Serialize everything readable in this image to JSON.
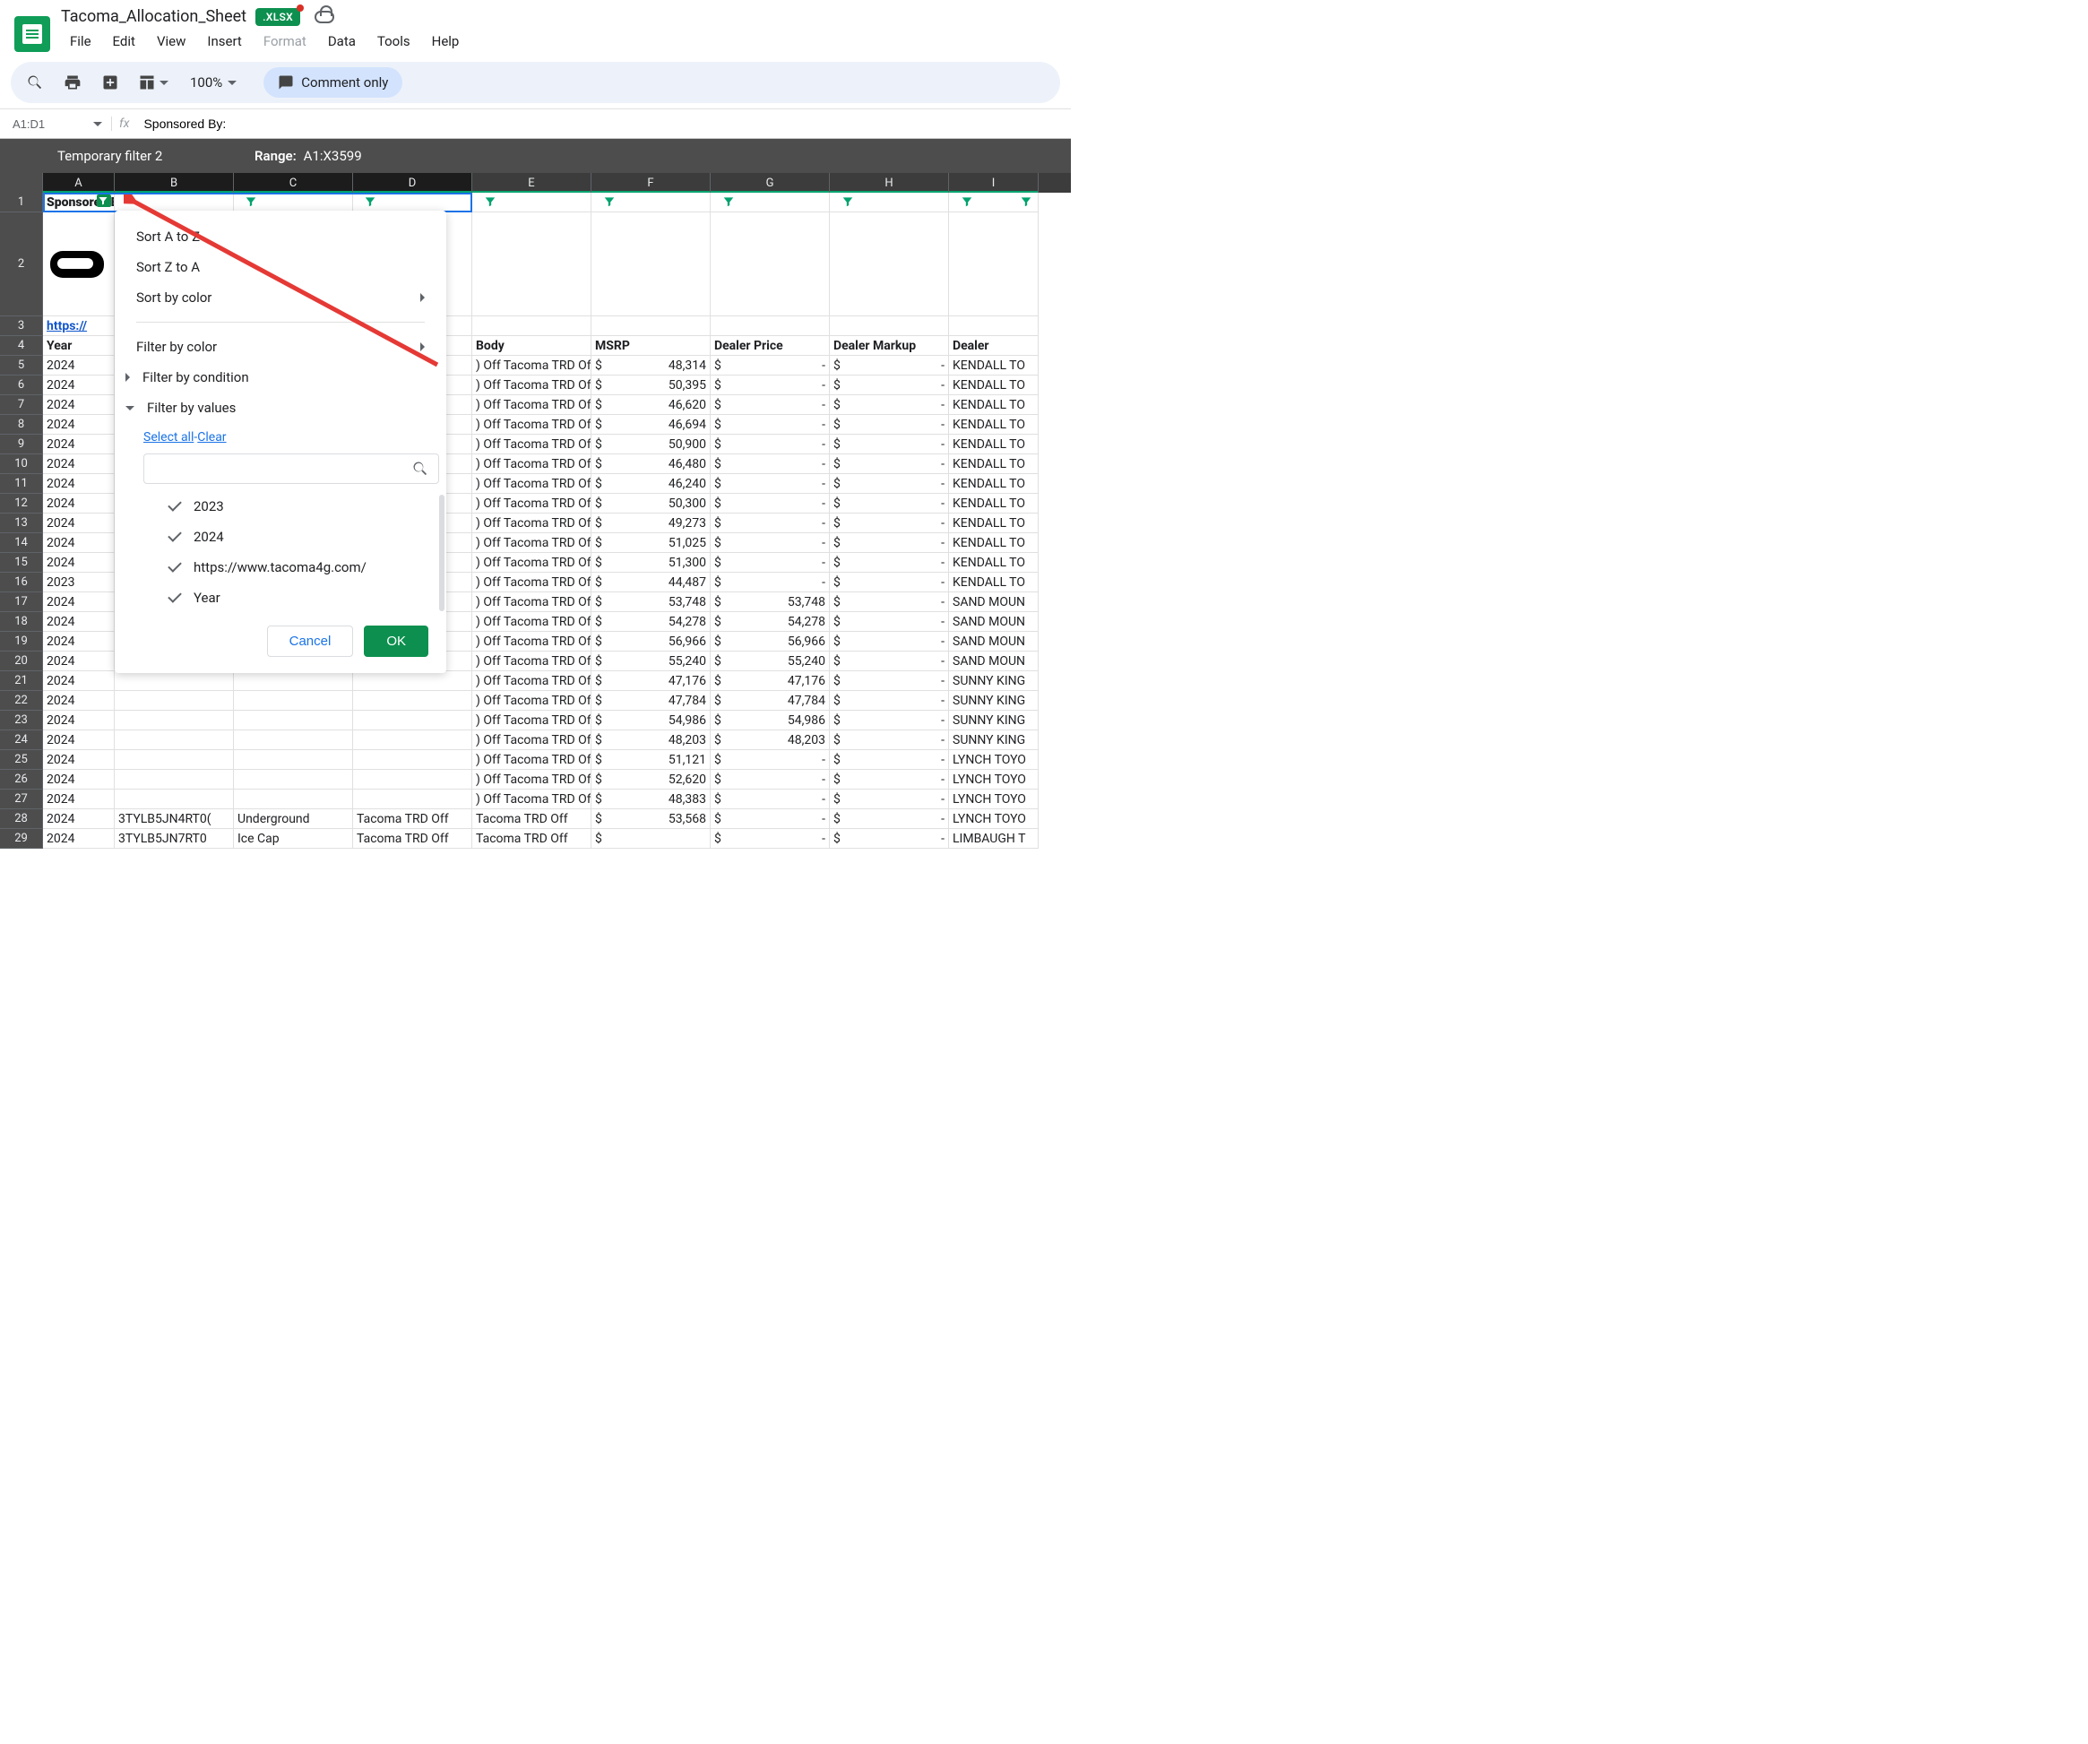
{
  "document": {
    "title": "Tacoma_Allocation_Sheet",
    "badge": ".XLSX"
  },
  "menu": {
    "file": "File",
    "edit": "Edit",
    "view": "View",
    "insert": "Insert",
    "format": "Format",
    "data": "Data",
    "tools": "Tools",
    "help": "Help"
  },
  "toolbar": {
    "zoom": "100%",
    "comment_only": "Comment only"
  },
  "formula_bar": {
    "name_box": "A1:D1",
    "fx": "fx",
    "formula": "Sponsored By:"
  },
  "filter_bar": {
    "name": "Temporary filter 2",
    "range_label": "Range:",
    "range": "A1:X3599"
  },
  "columns": [
    "A",
    "B",
    "C",
    "D",
    "E",
    "F",
    "G",
    "H",
    "I"
  ],
  "rows": [
    "1",
    "2",
    "3",
    "4",
    "5",
    "6",
    "7",
    "8",
    "9",
    "10",
    "11",
    "12",
    "13",
    "14",
    "15",
    "16",
    "17",
    "18",
    "19",
    "20",
    "21",
    "22",
    "23",
    "24",
    "25",
    "26",
    "27",
    "28",
    "29"
  ],
  "cells": {
    "r1_a": "Sponsored By:",
    "r3_a": "https://",
    "r4": {
      "a": "Year",
      "e": "Body",
      "f": "MSRP",
      "g": "Dealer Price",
      "h": "Dealer Markup",
      "i": "Dealer"
    }
  },
  "data_rows": [
    {
      "year": "2024",
      "body": ") Off Tacoma TRD Off",
      "msrp": "48,314",
      "dp": "-",
      "dm": "-",
      "dealer": "KENDALL TO"
    },
    {
      "year": "2024",
      "body": ") Off Tacoma TRD Off",
      "msrp": "50,395",
      "dp": "-",
      "dm": "-",
      "dealer": "KENDALL TO"
    },
    {
      "year": "2024",
      "body": ") Off Tacoma TRD Off",
      "msrp": "46,620",
      "dp": "-",
      "dm": "-",
      "dealer": "KENDALL TO"
    },
    {
      "year": "2024",
      "body": ") Off Tacoma TRD Off",
      "msrp": "46,694",
      "dp": "-",
      "dm": "-",
      "dealer": "KENDALL TO"
    },
    {
      "year": "2024",
      "body": ") Off Tacoma TRD Off",
      "msrp": "50,900",
      "dp": "-",
      "dm": "-",
      "dealer": "KENDALL TO"
    },
    {
      "year": "2024",
      "body": ") Off Tacoma TRD Off",
      "msrp": "46,480",
      "dp": "-",
      "dm": "-",
      "dealer": "KENDALL TO"
    },
    {
      "year": "2024",
      "body": ") Off Tacoma TRD Off",
      "msrp": "46,240",
      "dp": "-",
      "dm": "-",
      "dealer": "KENDALL TO"
    },
    {
      "year": "2024",
      "body": ") Off Tacoma TRD Off",
      "msrp": "50,300",
      "dp": "-",
      "dm": "-",
      "dealer": "KENDALL TO"
    },
    {
      "year": "2024",
      "body": ") Off Tacoma TRD Off",
      "msrp": "49,273",
      "dp": "-",
      "dm": "-",
      "dealer": "KENDALL TO"
    },
    {
      "year": "2024",
      "body": ") Off Tacoma TRD Off",
      "msrp": "51,025",
      "dp": "-",
      "dm": "-",
      "dealer": "KENDALL TO"
    },
    {
      "year": "2024",
      "body": ") Off Tacoma TRD Off",
      "msrp": "51,300",
      "dp": "-",
      "dm": "-",
      "dealer": "KENDALL TO"
    },
    {
      "year": "2023",
      "body": ") Off Tacoma TRD Off",
      "msrp": "44,487",
      "dp": "-",
      "dm": "-",
      "dealer": "KENDALL TO"
    },
    {
      "year": "2024",
      "body": ") Off Tacoma TRD Off",
      "msrp": "53,748",
      "dp": "53,748",
      "dm": "-",
      "dealer": "SAND MOUN"
    },
    {
      "year": "2024",
      "body": ") Off Tacoma TRD Off",
      "msrp": "54,278",
      "dp": "54,278",
      "dm": "-",
      "dealer": "SAND MOUN"
    },
    {
      "year": "2024",
      "body": ") Off Tacoma TRD Off",
      "msrp": "56,966",
      "dp": "56,966",
      "dm": "-",
      "dealer": "SAND MOUN"
    },
    {
      "year": "2024",
      "body": ") Off Tacoma TRD Off",
      "msrp": "55,240",
      "dp": "55,240",
      "dm": "-",
      "dealer": "SAND MOUN"
    },
    {
      "year": "2024",
      "body": ") Off Tacoma TRD Off",
      "msrp": "47,176",
      "dp": "47,176",
      "dm": "-",
      "dealer": "SUNNY KING"
    },
    {
      "year": "2024",
      "body": ") Off Tacoma TRD Off",
      "msrp": "47,784",
      "dp": "47,784",
      "dm": "-",
      "dealer": "SUNNY KING"
    },
    {
      "year": "2024",
      "body": ") Off Tacoma TRD Off",
      "msrp": "54,986",
      "dp": "54,986",
      "dm": "-",
      "dealer": "SUNNY KING"
    },
    {
      "year": "2024",
      "body": ") Off Tacoma TRD Off",
      "msrp": "48,203",
      "dp": "48,203",
      "dm": "-",
      "dealer": "SUNNY KING"
    },
    {
      "year": "2024",
      "body": ") Off Tacoma TRD Off",
      "msrp": "51,121",
      "dp": "-",
      "dm": "-",
      "dealer": "LYNCH TOYO"
    },
    {
      "year": "2024",
      "body": ") Off Tacoma TRD Off",
      "msrp": "52,620",
      "dp": "-",
      "dm": "-",
      "dealer": "LYNCH TOYO"
    },
    {
      "year": "2024",
      "body": ") Off Tacoma TRD Off",
      "msrp": "48,383",
      "dp": "-",
      "dm": "-",
      "dealer": "LYNCH TOYO"
    },
    {
      "year": "2024",
      "vin": "3TYLB5JN4RT0(",
      "color": "Underground",
      "trim": "Tacoma TRD Off",
      "body": "Tacoma TRD Off",
      "msrp": "53,568",
      "dp": "-",
      "dm": "-",
      "dealer": "LYNCH TOYO"
    },
    {
      "year": "2024",
      "vin": "3TYLB5JN7RT0",
      "color": "Ice Cap",
      "trim": "Tacoma TRD Off",
      "body": "Tacoma TRD Off",
      "msrp": "",
      "dp": "-",
      "dm": "-",
      "dealer": "LIMBAUGH T"
    }
  ],
  "dropdown": {
    "sort_az": "Sort A to Z",
    "sort_za": "Sort Z to A",
    "sort_color": "Sort by color",
    "filter_color": "Filter by color",
    "filter_condition": "Filter by condition",
    "filter_values": "Filter by values",
    "select_all": "Select all",
    "clear": "Clear",
    "search_placeholder": "",
    "values": [
      "2023",
      "2024",
      "https://www.tacoma4g.com/",
      "Year"
    ],
    "cancel": "Cancel",
    "ok": "OK"
  }
}
